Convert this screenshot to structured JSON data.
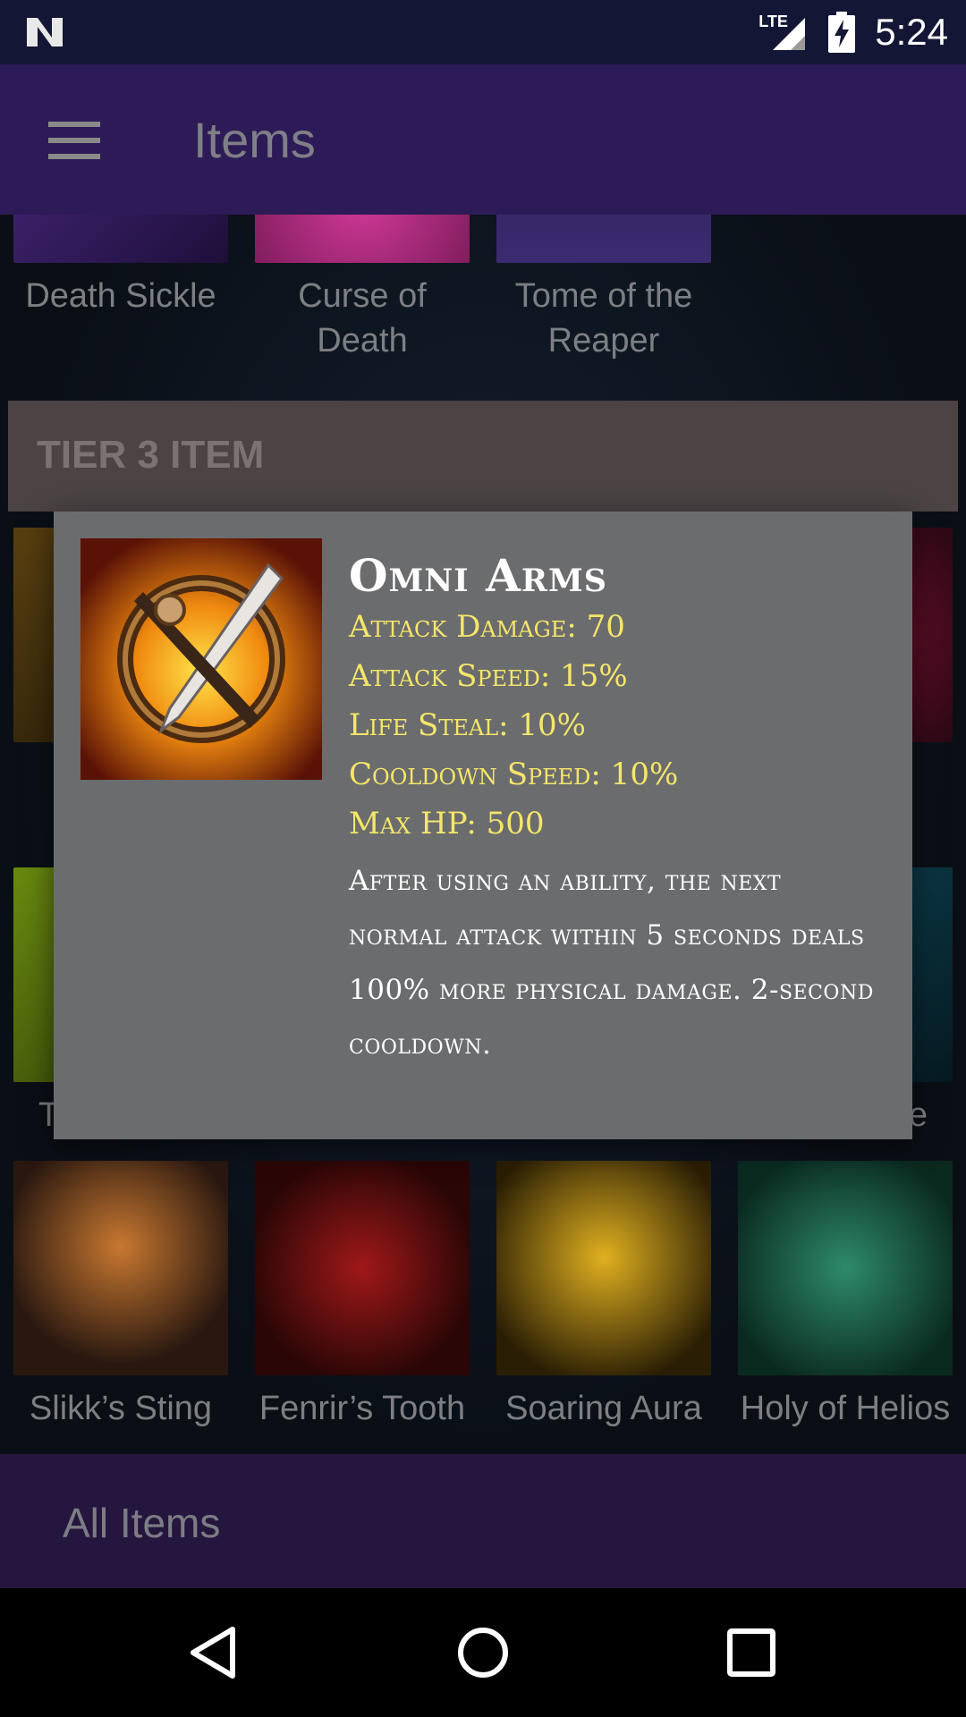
{
  "status_bar": {
    "time": "5:24",
    "network": "LTE"
  },
  "app_bar": {
    "title": "Items",
    "menu_icon": "hamburger-menu-icon"
  },
  "top_row": [
    {
      "name": "Death Sickle",
      "color": "#3c1f6a"
    },
    {
      "name": "Curse of Death",
      "color": "#6a1a4a"
    },
    {
      "name": "Tome of the Reaper",
      "color": "#2a1e40"
    }
  ],
  "tier_header": "TIER 3 ITEM",
  "bottom_row": [
    {
      "name": "Slikk’s Sting",
      "color": "#3a2a20"
    },
    {
      "name": "Fenrir’s Tooth",
      "color": "#3a0c0c"
    },
    {
      "name": "Soaring Aura",
      "color": "#6a5010"
    },
    {
      "name": "Holy of Helios",
      "color": "#1c4a3c"
    }
  ],
  "hidden_row_partial": {
    "left_peek_label": "T",
    "right_peek_label": "se"
  },
  "dialog": {
    "title": "Omni Arms",
    "stats": [
      "Attack Damage: 70",
      "Attack Speed: 15%",
      "Life Steal: 10%",
      "Cooldown Speed: 10%",
      "Max HP: 500"
    ],
    "description": "After using an ability, the next normal attack within 5 seconds deals 100% more physical damage. 2-second cooldown.",
    "accent_color": "#f5e66a"
  },
  "bottom_bar": {
    "label": "All Items"
  },
  "nav": {
    "back": "back-icon",
    "home": "home-icon",
    "recents": "recents-icon"
  }
}
